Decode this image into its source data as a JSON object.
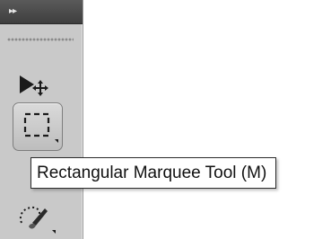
{
  "panel": {
    "collapse_glyph": "▸▸",
    "background_color": "#c9c9c9",
    "header_color": "#4a4a4a"
  },
  "tools": [
    {
      "name": "move",
      "icon": "move-icon",
      "selected": false
    },
    {
      "name": "rectangular-marquee",
      "icon": "marquee-icon",
      "selected": true,
      "has_flyout": true
    },
    {
      "name": "lasso",
      "icon": "lasso-icon",
      "selected": false,
      "has_flyout": true
    }
  ],
  "tooltip": {
    "text": "Rectangular Marquee Tool (M)"
  }
}
